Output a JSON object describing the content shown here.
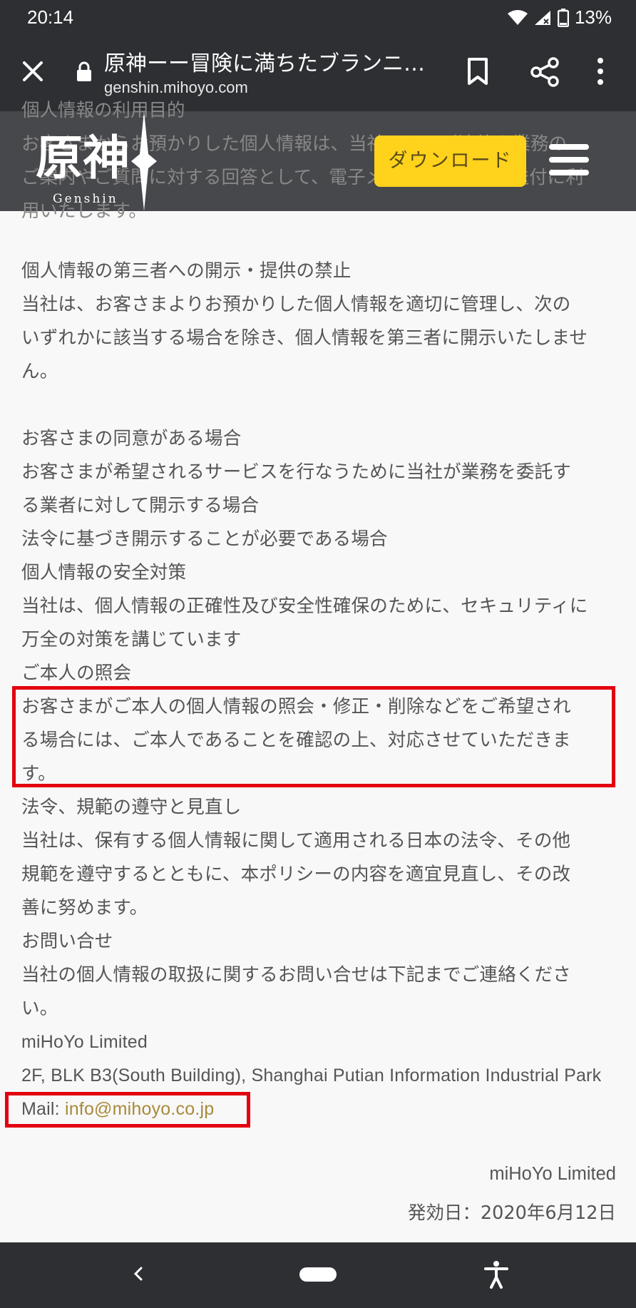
{
  "status": {
    "time": "20:14",
    "battery": "13%"
  },
  "toolbar": {
    "title": "原神ーー冒険に満ちたブランニ…",
    "url": "genshin.mihoyo.com"
  },
  "header": {
    "logo_text": "原神",
    "logo_sub": "Genshin",
    "download_label": "ダウンロード",
    "behind_lines": [
      "個人情報の利用目的",
      "お客さまからお預かりした個人情報は、当社からのご連絡や業務の",
      "ご案内やご質問に対する回答として、電子メールや資料のご送付に利",
      "用いたします。"
    ]
  },
  "content": {
    "blocks": [
      "個人情報の第三者への開示・提供の禁止",
      "当社は、お客さまよりお預かりした個人情報を適切に管理し、次の",
      "いずれかに該当する場合を除き、個人情報を第三者に開示いたしませ",
      "ん。",
      "",
      "お客さまの同意がある場合",
      "お客さまが希望されるサービスを行なうために当社が業務を委託す",
      "る業者に対して開示する場合",
      "法令に基づき開示することが必要である場合",
      "個人情報の安全対策",
      "当社は、個人情報の正確性及び安全性確保のために、セキュリティに",
      "万全の対策を講じています",
      "ご本人の照会",
      "お客さまがご本人の個人情報の照会・修正・削除などをご希望され",
      "る場合には、ご本人であることを確認の上、対応させていただきま",
      "す。",
      "法令、規範の遵守と見直し",
      "当社は、保有する個人情報に関して適用される日本の法令、その他",
      "規範を遵守するとともに、本ポリシーの内容を適宜見直し、その改",
      "善に努めます。",
      "お問い合せ",
      "当社の個人情報の取扱に関するお問い合せは下記までご連絡くださ",
      "い。"
    ],
    "company": "miHoYo Limited",
    "address": "2F, BLK B3(South Building), Shanghai Putian Information Industrial Park",
    "mail_label": "Mail: ",
    "mail_value": "info@mihoyo.co.jp",
    "footer_company": "miHoYo Limited",
    "effective_date": "発効日：2020年6月12日"
  },
  "colors": {
    "highlight_box": "#e3000f",
    "download_button": "#ffd21c",
    "link": "#a88a3a"
  },
  "icons": [
    "wifi-icon",
    "signal-icon",
    "battery-icon",
    "close-icon",
    "lock-icon",
    "bookmark-icon",
    "share-icon",
    "more-icon",
    "menu-icon",
    "back-icon",
    "home-pill",
    "accessibility-icon"
  ]
}
